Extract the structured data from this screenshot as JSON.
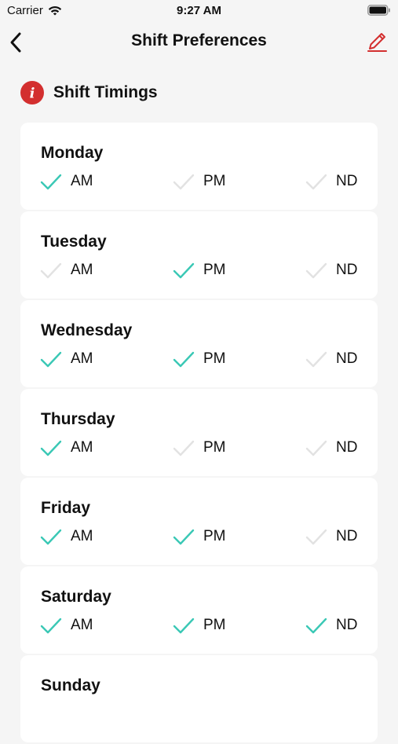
{
  "status_bar": {
    "carrier": "Carrier",
    "time": "9:27 AM"
  },
  "nav": {
    "title": "Shift Preferences"
  },
  "section": {
    "title": "Shift Timings",
    "info_icon_letter": "i"
  },
  "colors": {
    "checked": "#3ac8b5",
    "unchecked": "#e2e2e2",
    "accent_red": "#d32f2f"
  },
  "shift_labels": [
    "AM",
    "PM",
    "ND"
  ],
  "days": [
    {
      "name": "Monday",
      "shifts": [
        true,
        false,
        false
      ]
    },
    {
      "name": "Tuesday",
      "shifts": [
        false,
        true,
        false
      ]
    },
    {
      "name": "Wednesday",
      "shifts": [
        true,
        true,
        false
      ]
    },
    {
      "name": "Thursday",
      "shifts": [
        true,
        false,
        false
      ]
    },
    {
      "name": "Friday",
      "shifts": [
        true,
        true,
        false
      ]
    },
    {
      "name": "Saturday",
      "shifts": [
        true,
        true,
        true
      ]
    },
    {
      "name": "Sunday",
      "shifts": [
        null,
        null,
        null
      ]
    }
  ]
}
